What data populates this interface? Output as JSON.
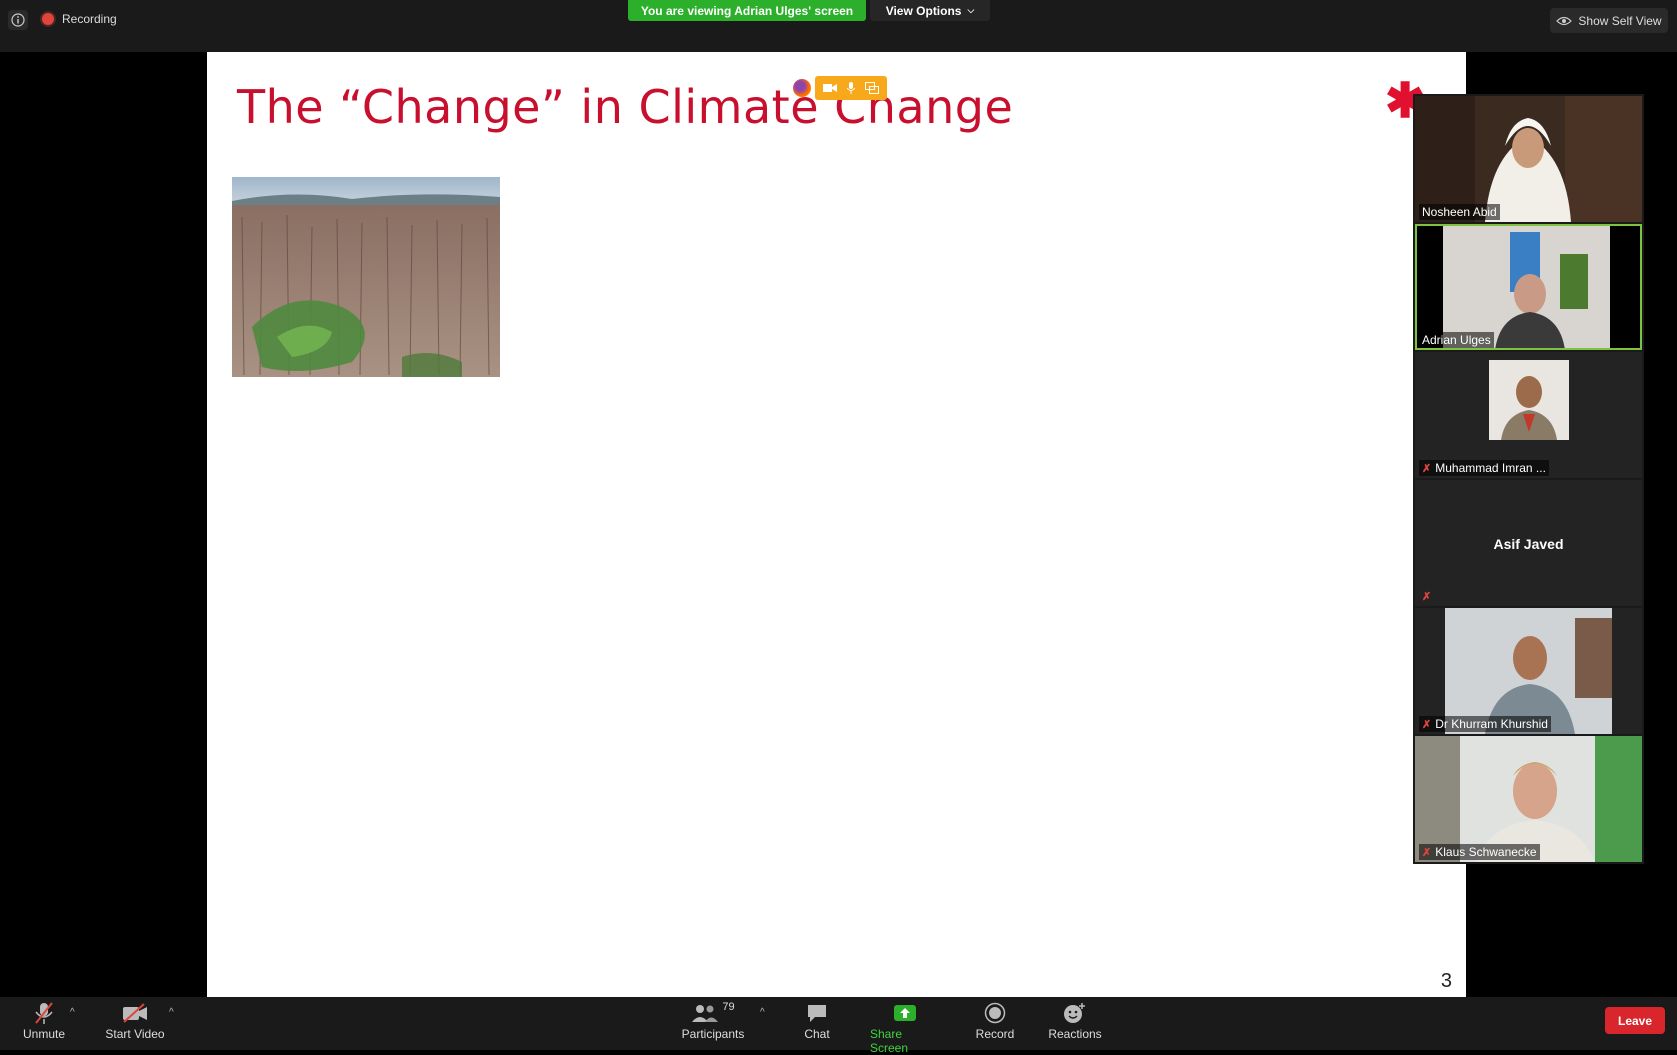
{
  "topbar": {
    "recording_label": "Recording",
    "viewing_banner": "You are viewing Adrian Ulges' screen",
    "view_options_label": "View Options",
    "self_view_label": "Show Self View"
  },
  "slide": {
    "title": "The “Change” in Climate Change",
    "page_number": "3"
  },
  "participants_gallery": [
    {
      "name": "Nosheen Abid",
      "muted": false,
      "video": true,
      "active": false
    },
    {
      "name": "Adrian Ulges",
      "muted": false,
      "video": true,
      "active": true
    },
    {
      "name": "Muhammad Imran ...",
      "muted": true,
      "video": true,
      "active": false
    },
    {
      "name": "Asif Javed",
      "muted": true,
      "video": false,
      "active": false
    },
    {
      "name": "Dr Khurram Khurshid",
      "muted": true,
      "video": true,
      "active": false
    },
    {
      "name": "Klaus Schwanecke",
      "muted": true,
      "video": true,
      "active": false
    }
  ],
  "toolbar": {
    "unmute_label": "Unmute",
    "start_video_label": "Start Video",
    "participants_label": "Participants",
    "participants_count": "79",
    "chat_label": "Chat",
    "share_screen_label": "Share Screen",
    "record_label": "Record",
    "reactions_label": "Reactions",
    "leave_label": "Leave"
  },
  "colors": {
    "accent_green": "#2cb02c",
    "slide_title_red": "#c8102e",
    "leave_red": "#d9262c",
    "active_speaker_border": "#7fc241"
  }
}
